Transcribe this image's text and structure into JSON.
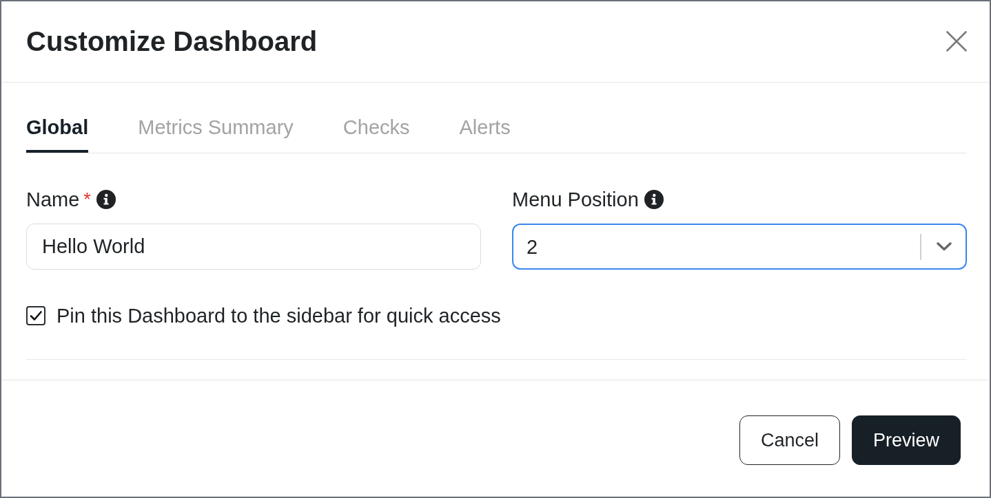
{
  "dialog": {
    "title": "Customize Dashboard"
  },
  "tabs": [
    {
      "label": "Global",
      "selected": true
    },
    {
      "label": "Metrics Summary",
      "selected": false
    },
    {
      "label": "Checks",
      "selected": false
    },
    {
      "label": "Alerts",
      "selected": false
    }
  ],
  "fields": [
    {
      "kind": "text",
      "label": "Name",
      "required_mark": "*",
      "value": "Hello World",
      "focused": false
    },
    {
      "kind": "select",
      "label": "Menu Position",
      "value": "2",
      "focused": true
    }
  ],
  "checkbox": {
    "label": "Pin this Dashboard to the sidebar for quick access",
    "checked": true
  },
  "buttons": [
    {
      "label": "Cancel",
      "kind": "secondary"
    },
    {
      "label": "Preview",
      "kind": "primary"
    }
  ]
}
